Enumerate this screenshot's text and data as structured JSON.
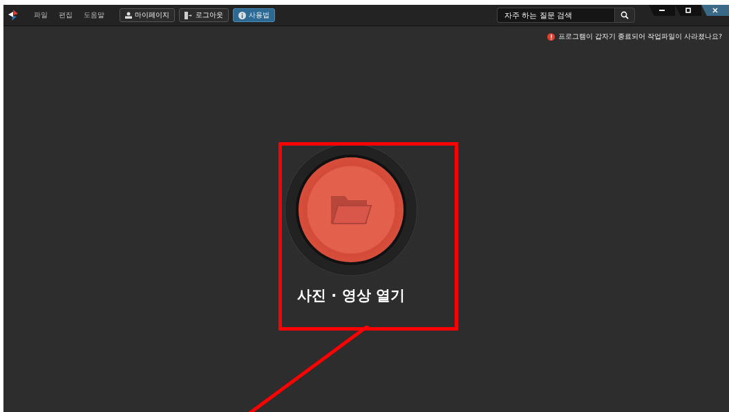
{
  "menu": [
    {
      "label": "파일"
    },
    {
      "label": "편집"
    },
    {
      "label": "도움말"
    }
  ],
  "toolbar_buttons": [
    {
      "kind": "user",
      "label": "마이페이지",
      "selected": false
    },
    {
      "kind": "logout",
      "label": "로그아웃",
      "selected": false
    },
    {
      "kind": "info",
      "label": "사용법",
      "selected": true
    }
  ],
  "search": {
    "placeholder": "자주 하는 질문 검색"
  },
  "notice": {
    "text": "프로그램이 갑자기 종료되어 작업파일이 사라졌나요?"
  },
  "open_button": {
    "label": "사진 · 영상 열기"
  },
  "annotation": {
    "highlighted": true
  }
}
